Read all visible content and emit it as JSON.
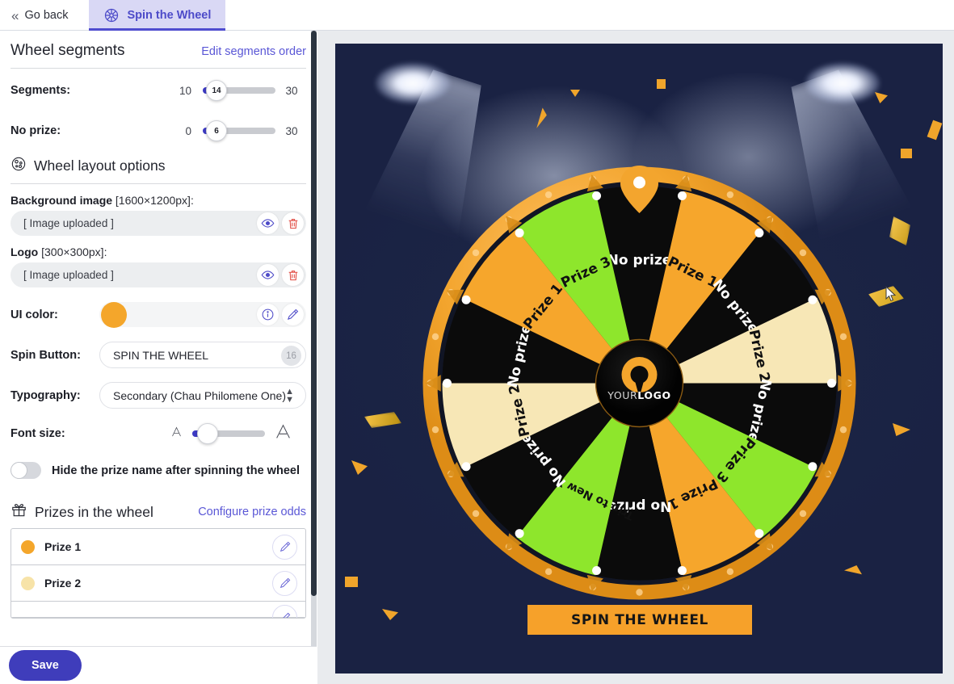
{
  "tabs": {
    "back_label": "Go back",
    "back_icon": "double-chevron-left-icon",
    "active_label": "Spin the Wheel",
    "active_icon": "spin-wheel-icon"
  },
  "wheel_segments": {
    "title": "Wheel segments",
    "edit_link": "Edit segments order",
    "sliders": [
      {
        "label": "Segments:",
        "min": "10",
        "value": "14",
        "max": "30",
        "fill_pct": 14
      },
      {
        "label": "No prize:",
        "min": "0",
        "value": "6",
        "max": "30",
        "fill_pct": 12
      }
    ]
  },
  "layout_options": {
    "title": "Wheel layout options",
    "icon": "wheel-options-icon",
    "background_image": {
      "label_bold": "Background image",
      "label_dims": " [1600×1200px]:",
      "value": "[ Image uploaded ]",
      "preview_icon": "eye-icon",
      "delete_icon": "trash-icon"
    },
    "logo": {
      "label_bold": "Logo",
      "label_dims": " [300×300px]:",
      "value": "[ Image uploaded ]",
      "preview_icon": "eye-icon",
      "delete_icon": "trash-icon"
    },
    "ui_color": {
      "label": "UI color:",
      "swatch_hex": "#f4a62b",
      "info_icon": "info-icon",
      "edit_icon": "pencil-icon"
    },
    "spin_button": {
      "label": "Spin Button:",
      "value": "SPIN THE WHEEL",
      "char_count": "16"
    },
    "typography": {
      "label": "Typography:",
      "value": "Secondary (Chau Philomene One)",
      "caret_icon": "up-down-caret-icon"
    },
    "font_size": {
      "label": "Font size:",
      "small_icon": "small-A-icon",
      "large_icon": "large-A-icon",
      "fill_pct": 14
    },
    "hide_prize_toggle": {
      "label": "Hide the prize name after spinning the wheel",
      "state": "off"
    }
  },
  "prizes_section": {
    "title": "Prizes in the wheel",
    "icon": "gift-icon",
    "link": "Configure prize odds",
    "items": [
      {
        "name": "Prize 1",
        "color": "#f4a62b",
        "edit_icon": "pencil-icon"
      },
      {
        "name": "Prize 2",
        "color": "#f7e3a8",
        "edit_icon": "pencil-icon"
      }
    ]
  },
  "footer": {
    "save_label": "Save"
  },
  "preview": {
    "spin_button_label": "SPIN THE WHEEL",
    "logo_text_light": "YOUR",
    "logo_text_bold": "LOGO",
    "background_hex": "#1f2849",
    "rim_hex": "#f3a52e",
    "pointer_icon": "wheel-pointer-icon",
    "cursor_icon": "mouse-cursor-icon",
    "segment_colors": {
      "orange": "#f6a62c",
      "black": "#0b0b0b",
      "green": "#8ee62c",
      "cream": "#f7e7b6"
    },
    "segments": [
      {
        "label": "No prize",
        "color": "black"
      },
      {
        "label": "Prize 1",
        "color": "orange"
      },
      {
        "label": "No prize",
        "color": "black"
      },
      {
        "label": "Prize 2",
        "color": "cream"
      },
      {
        "label": "No prize",
        "color": "black"
      },
      {
        "label": "Prize 3",
        "color": "green"
      },
      {
        "label": "Prize 1",
        "color": "orange"
      },
      {
        "label": "No prize",
        "color": "black"
      },
      {
        "label": "Trip to New York",
        "color": "green"
      },
      {
        "label": "No prize",
        "color": "black"
      },
      {
        "label": "Prize 2",
        "color": "cream"
      },
      {
        "label": "No prize",
        "color": "black"
      },
      {
        "label": "Prize 1",
        "color": "orange"
      },
      {
        "label": "Prize 3",
        "color": "green"
      }
    ]
  }
}
